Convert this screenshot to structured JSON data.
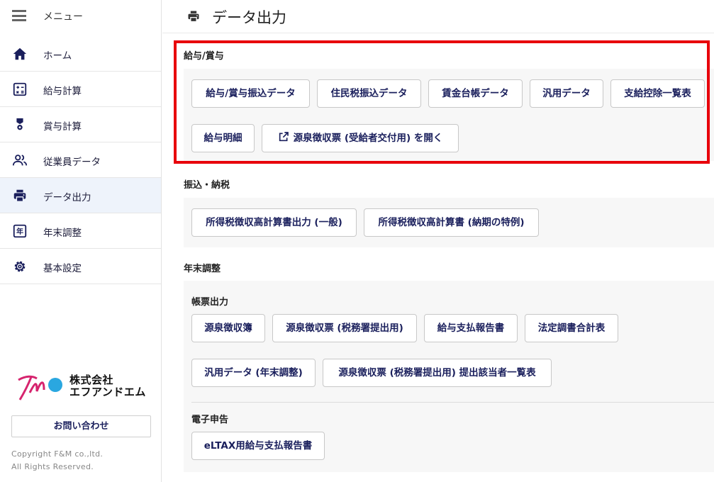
{
  "sidebar": {
    "menu_label": "メニュー",
    "items": [
      {
        "label": "ホーム",
        "icon": "home-icon"
      },
      {
        "label": "給与計算",
        "icon": "calculator-icon"
      },
      {
        "label": "賞与計算",
        "icon": "award-icon"
      },
      {
        "label": "従業員データ",
        "icon": "people-icon"
      },
      {
        "label": "データ出力",
        "icon": "printer-icon",
        "active": true
      },
      {
        "label": "年末調整",
        "icon": "year-icon"
      },
      {
        "label": "基本設定",
        "icon": "gear-icon"
      }
    ],
    "company_line1": "株式会社",
    "company_line2": "エフアンドエム",
    "contact_button": "お問い合わせ",
    "copyright_line1": "Copyright F&M co.,ltd.",
    "copyright_line2": "All Rights Reserved."
  },
  "header": {
    "title": "データ出力"
  },
  "sections": {
    "salary_bonus": {
      "title": "給与/賞与",
      "buttons": [
        "給与/賞与振込データ",
        "住民税振込データ",
        "賃金台帳データ",
        "汎用データ",
        "支給控除一覧表",
        "給与明細",
        "源泉徴収票 (受給者交付用) を開く"
      ]
    },
    "transfer_tax": {
      "title": "振込・納税",
      "buttons": [
        "所得税徴収高計算書出力 (一般)",
        "所得税徴収高計算書 (納期の特例)"
      ]
    },
    "year_end": {
      "title": "年末調整",
      "forms_title": "帳票出力",
      "forms_buttons": [
        "源泉徴収簿",
        "源泉徴収票 (税務署提出用)",
        "給与支払報告書",
        "法定調書合計表",
        "汎用データ (年末調整)",
        "源泉徴収票 (税務署提出用) 提出該当者一覧表"
      ],
      "efile_title": "電子申告",
      "efile_buttons": [
        "eLTAX用給与支払報告書"
      ]
    }
  },
  "colors": {
    "highlight": "#e8000b",
    "button_text": "#1a1f5c",
    "active_nav": "#eef3fb"
  }
}
